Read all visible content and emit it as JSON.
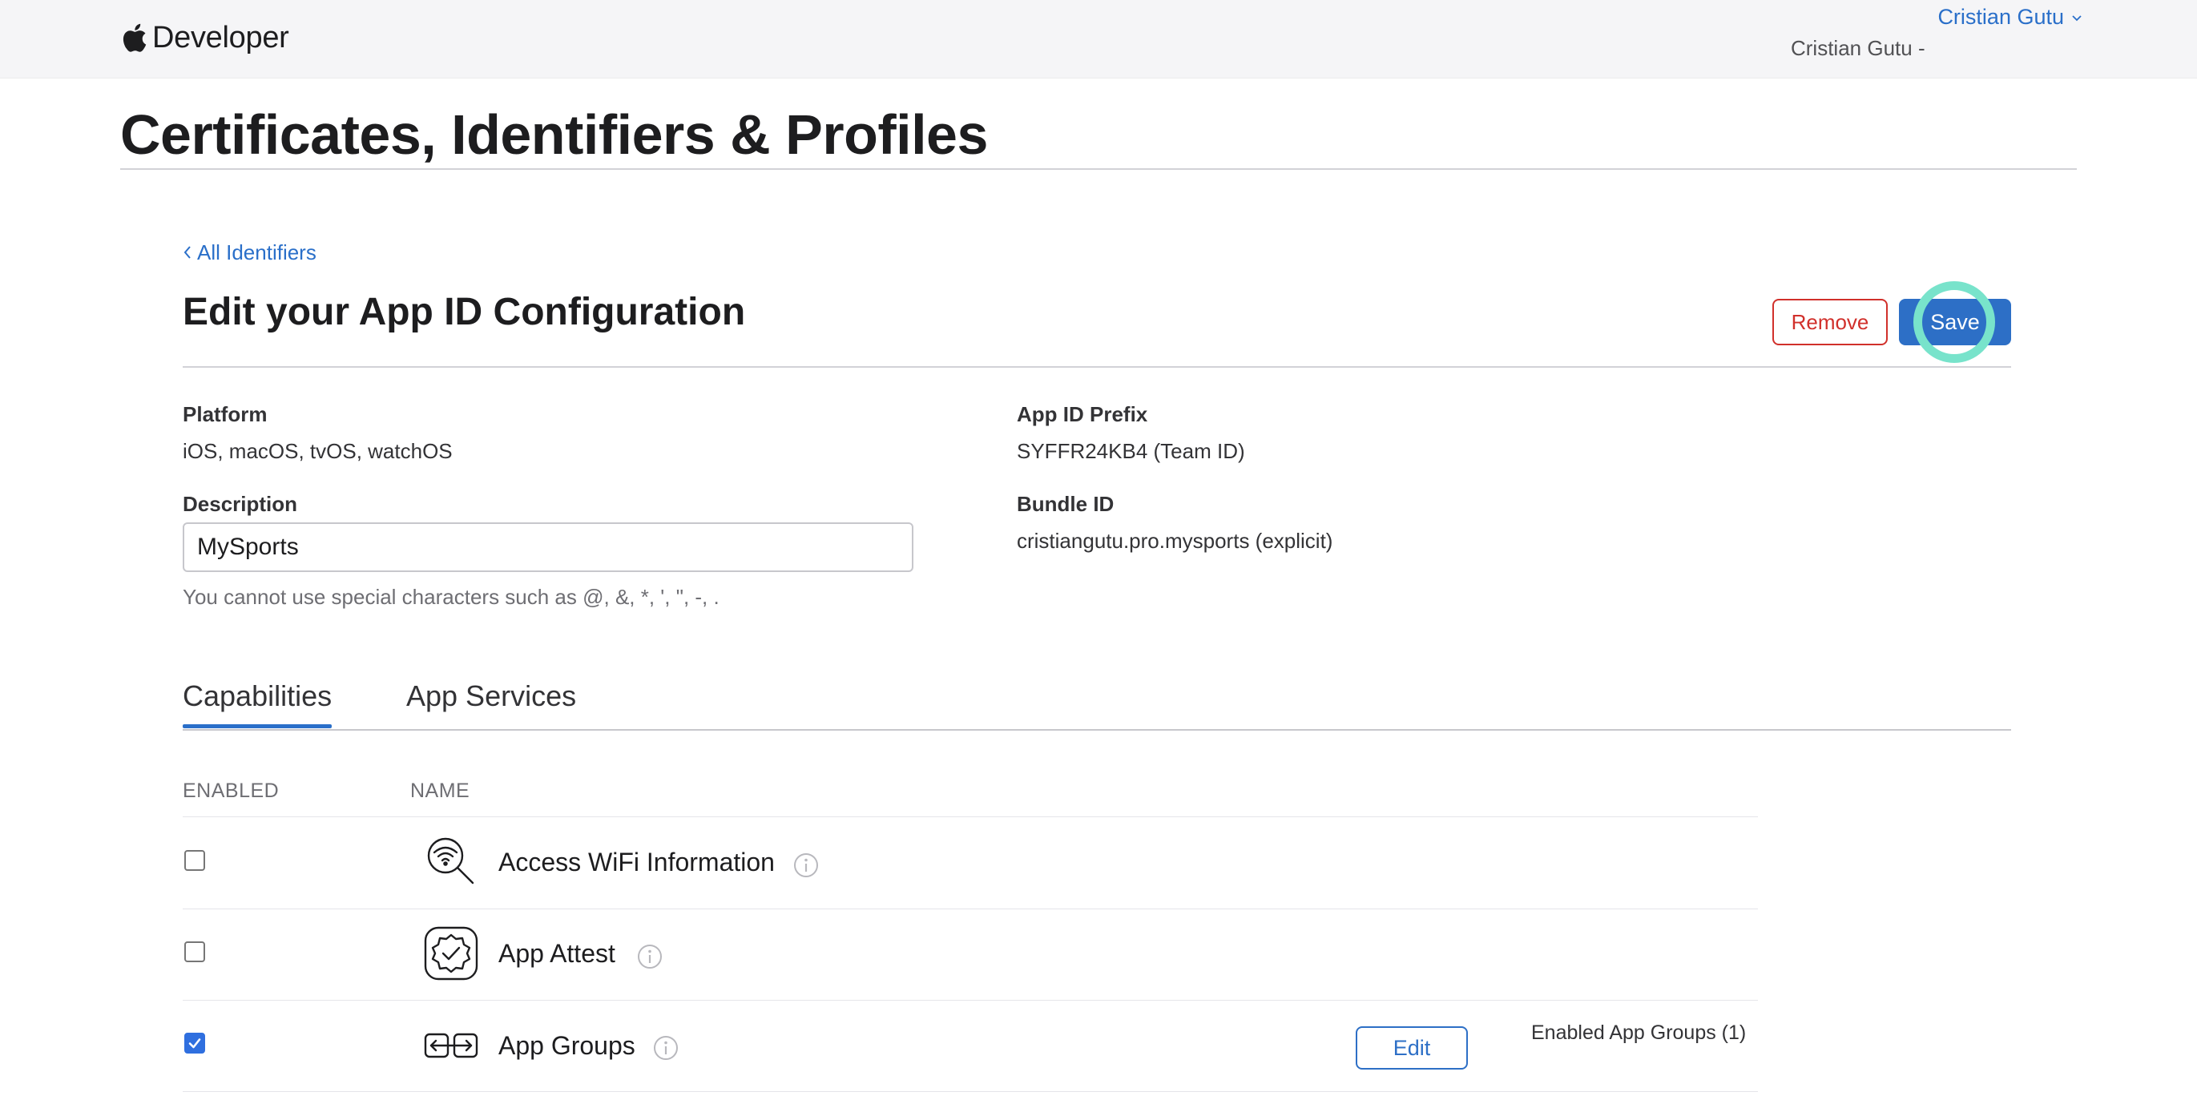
{
  "nav": {
    "brand_text": "Developer",
    "user_name": "Cristian Gutu",
    "team_name": "Cristian Gutu -"
  },
  "page": {
    "title": "Certificates, Identifiers & Profiles"
  },
  "section": {
    "back_link": "All Identifiers",
    "title": "Edit your App ID Configuration",
    "remove_label": "Remove",
    "save_label": "Save"
  },
  "fields": {
    "platform_label": "Platform",
    "platform_value": "iOS, macOS, tvOS, watchOS",
    "app_id_prefix_label": "App ID Prefix",
    "app_id_prefix_value": "SYFFR24KB4 (Team ID)",
    "description_label": "Description",
    "description_value": "MySports",
    "description_hint": "You cannot use special characters such as @, &, *, ', \", -, .",
    "bundle_id_label": "Bundle ID",
    "bundle_id_value": "cristiangutu.pro.mysports (explicit)"
  },
  "tabs": [
    {
      "label": "Capabilities",
      "active": true
    },
    {
      "label": "App Services",
      "active": false
    }
  ],
  "table": {
    "col_enabled": "ENABLED",
    "col_name": "NAME",
    "rows": [
      {
        "name": "Access WiFi Information",
        "enabled": false,
        "icon": "wifi-search-icon"
      },
      {
        "name": "App Attest",
        "enabled": false,
        "icon": "badge-check-icon"
      },
      {
        "name": "App Groups",
        "enabled": true,
        "icon": "app-groups-icon",
        "edit_label": "Edit",
        "status": "Enabled App Groups (1)"
      }
    ]
  },
  "colors": {
    "accent": "#2d6fc6",
    "danger": "#d1302b",
    "click_highlight": "#78e3cb"
  }
}
